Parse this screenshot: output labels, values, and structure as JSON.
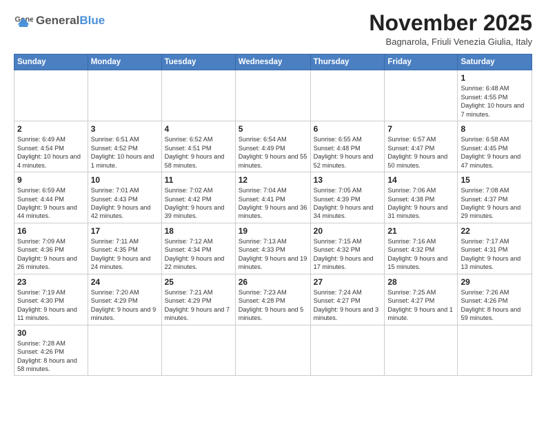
{
  "logo": {
    "text_general": "General",
    "text_blue": "Blue"
  },
  "header": {
    "title": "November 2025",
    "subtitle": "Bagnarola, Friuli Venezia Giulia, Italy"
  },
  "weekdays": [
    "Sunday",
    "Monday",
    "Tuesday",
    "Wednesday",
    "Thursday",
    "Friday",
    "Saturday"
  ],
  "weeks": [
    [
      {
        "day": "",
        "info": ""
      },
      {
        "day": "",
        "info": ""
      },
      {
        "day": "",
        "info": ""
      },
      {
        "day": "",
        "info": ""
      },
      {
        "day": "",
        "info": ""
      },
      {
        "day": "",
        "info": ""
      },
      {
        "day": "1",
        "info": "Sunrise: 6:48 AM\nSunset: 4:55 PM\nDaylight: 10 hours and 7 minutes."
      }
    ],
    [
      {
        "day": "2",
        "info": "Sunrise: 6:49 AM\nSunset: 4:54 PM\nDaylight: 10 hours and 4 minutes."
      },
      {
        "day": "3",
        "info": "Sunrise: 6:51 AM\nSunset: 4:52 PM\nDaylight: 10 hours and 1 minute."
      },
      {
        "day": "4",
        "info": "Sunrise: 6:52 AM\nSunset: 4:51 PM\nDaylight: 9 hours and 58 minutes."
      },
      {
        "day": "5",
        "info": "Sunrise: 6:54 AM\nSunset: 4:49 PM\nDaylight: 9 hours and 55 minutes."
      },
      {
        "day": "6",
        "info": "Sunrise: 6:55 AM\nSunset: 4:48 PM\nDaylight: 9 hours and 52 minutes."
      },
      {
        "day": "7",
        "info": "Sunrise: 6:57 AM\nSunset: 4:47 PM\nDaylight: 9 hours and 50 minutes."
      },
      {
        "day": "8",
        "info": "Sunrise: 6:58 AM\nSunset: 4:45 PM\nDaylight: 9 hours and 47 minutes."
      }
    ],
    [
      {
        "day": "9",
        "info": "Sunrise: 6:59 AM\nSunset: 4:44 PM\nDaylight: 9 hours and 44 minutes."
      },
      {
        "day": "10",
        "info": "Sunrise: 7:01 AM\nSunset: 4:43 PM\nDaylight: 9 hours and 42 minutes."
      },
      {
        "day": "11",
        "info": "Sunrise: 7:02 AM\nSunset: 4:42 PM\nDaylight: 9 hours and 39 minutes."
      },
      {
        "day": "12",
        "info": "Sunrise: 7:04 AM\nSunset: 4:41 PM\nDaylight: 9 hours and 36 minutes."
      },
      {
        "day": "13",
        "info": "Sunrise: 7:05 AM\nSunset: 4:39 PM\nDaylight: 9 hours and 34 minutes."
      },
      {
        "day": "14",
        "info": "Sunrise: 7:06 AM\nSunset: 4:38 PM\nDaylight: 9 hours and 31 minutes."
      },
      {
        "day": "15",
        "info": "Sunrise: 7:08 AM\nSunset: 4:37 PM\nDaylight: 9 hours and 29 minutes."
      }
    ],
    [
      {
        "day": "16",
        "info": "Sunrise: 7:09 AM\nSunset: 4:36 PM\nDaylight: 9 hours and 26 minutes."
      },
      {
        "day": "17",
        "info": "Sunrise: 7:11 AM\nSunset: 4:35 PM\nDaylight: 9 hours and 24 minutes."
      },
      {
        "day": "18",
        "info": "Sunrise: 7:12 AM\nSunset: 4:34 PM\nDaylight: 9 hours and 22 minutes."
      },
      {
        "day": "19",
        "info": "Sunrise: 7:13 AM\nSunset: 4:33 PM\nDaylight: 9 hours and 19 minutes."
      },
      {
        "day": "20",
        "info": "Sunrise: 7:15 AM\nSunset: 4:32 PM\nDaylight: 9 hours and 17 minutes."
      },
      {
        "day": "21",
        "info": "Sunrise: 7:16 AM\nSunset: 4:32 PM\nDaylight: 9 hours and 15 minutes."
      },
      {
        "day": "22",
        "info": "Sunrise: 7:17 AM\nSunset: 4:31 PM\nDaylight: 9 hours and 13 minutes."
      }
    ],
    [
      {
        "day": "23",
        "info": "Sunrise: 7:19 AM\nSunset: 4:30 PM\nDaylight: 9 hours and 11 minutes."
      },
      {
        "day": "24",
        "info": "Sunrise: 7:20 AM\nSunset: 4:29 PM\nDaylight: 9 hours and 9 minutes."
      },
      {
        "day": "25",
        "info": "Sunrise: 7:21 AM\nSunset: 4:29 PM\nDaylight: 9 hours and 7 minutes."
      },
      {
        "day": "26",
        "info": "Sunrise: 7:23 AM\nSunset: 4:28 PM\nDaylight: 9 hours and 5 minutes."
      },
      {
        "day": "27",
        "info": "Sunrise: 7:24 AM\nSunset: 4:27 PM\nDaylight: 9 hours and 3 minutes."
      },
      {
        "day": "28",
        "info": "Sunrise: 7:25 AM\nSunset: 4:27 PM\nDaylight: 9 hours and 1 minute."
      },
      {
        "day": "29",
        "info": "Sunrise: 7:26 AM\nSunset: 4:26 PM\nDaylight: 8 hours and 59 minutes."
      }
    ],
    [
      {
        "day": "30",
        "info": "Sunrise: 7:28 AM\nSunset: 4:26 PM\nDaylight: 8 hours and 58 minutes."
      },
      {
        "day": "",
        "info": ""
      },
      {
        "day": "",
        "info": ""
      },
      {
        "day": "",
        "info": ""
      },
      {
        "day": "",
        "info": ""
      },
      {
        "day": "",
        "info": ""
      },
      {
        "day": "",
        "info": ""
      }
    ]
  ]
}
